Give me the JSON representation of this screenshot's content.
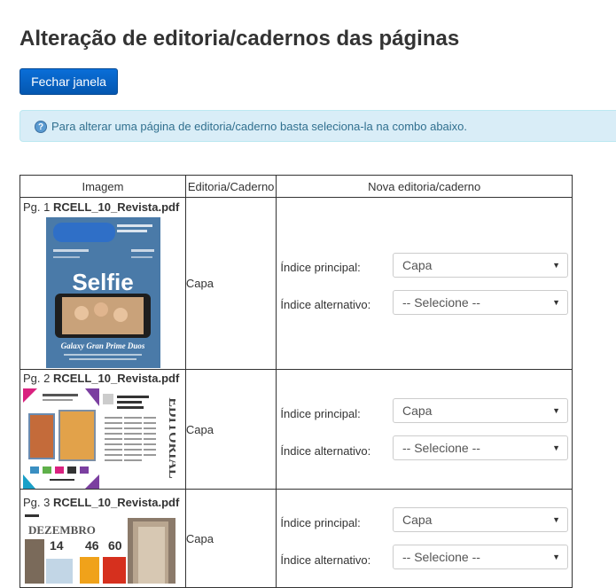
{
  "page": {
    "title": "Alteração de editoria/cadernos das páginas",
    "close_button": "Fechar janela",
    "info_icon": "question-circle-icon",
    "info_text": "Para alterar uma página de editoria/caderno basta seleciona-la na combo abaixo."
  },
  "table": {
    "headers": [
      "Imagem",
      "Editoria/Caderno",
      "Nova editoria/caderno"
    ],
    "field_labels": {
      "primary": "Índice principal:",
      "alternative": "Índice alternativo:"
    },
    "rows": [
      {
        "page_prefix": "Pg. 1",
        "file": "RCELL_10_Revista.pdf",
        "category": "Capa",
        "primary": "Capa",
        "alternative": "-- Selecione --",
        "thumb_text": "Selfie",
        "thumb_caption": "Galaxy Gran Prime Duos"
      },
      {
        "page_prefix": "Pg. 2",
        "file": "RCELL_10_Revista.pdf",
        "category": "Capa",
        "primary": "Capa",
        "alternative": "-- Selecione --",
        "thumb_text": "EDITORIAL"
      },
      {
        "page_prefix": "Pg. 3",
        "file": "RCELL_10_Revista.pdf",
        "category": "Capa",
        "primary": "Capa",
        "alternative": "-- Selecione --",
        "thumb_text": "DEZEMBRO",
        "thumb_numbers": [
          "14",
          "46",
          "60"
        ]
      }
    ]
  },
  "colors": {
    "button": "#0457b0",
    "alert_bg": "#d9edf7",
    "alert_text": "#31708f",
    "cover_blue": "#4a7aa8"
  }
}
